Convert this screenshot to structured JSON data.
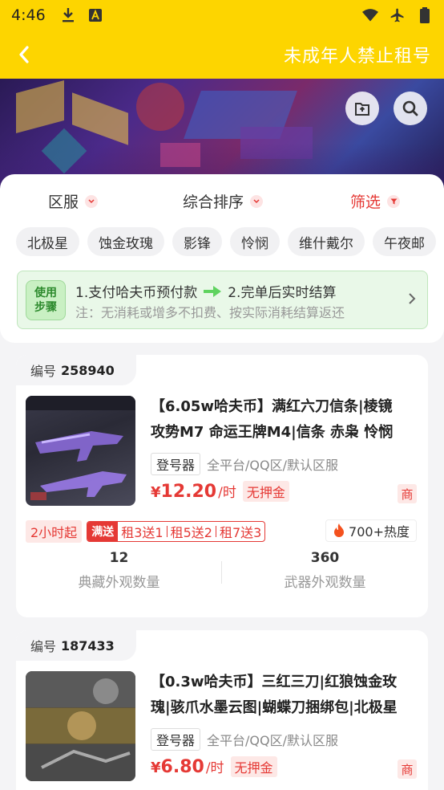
{
  "status_bar": {
    "time": "4:46"
  },
  "app_bar": {
    "title": "未成年人禁止租号"
  },
  "sort": {
    "region": "区服",
    "overall": "综合排序",
    "filter": "筛选"
  },
  "chips": [
    "北极星",
    "蚀金玫瑰",
    "影锋",
    "怜悯",
    "维什戴尔",
    "午夜邮"
  ],
  "steps": {
    "badge_line1": "使用",
    "badge_line2": "步骤",
    "step1": "1.支付哈夫币预付款",
    "step2": "2.完单后实时结算",
    "note": "注：无消耗或增多不扣费、按实际消耗结算返还"
  },
  "listings": [
    {
      "no_label": "编号",
      "no": "258940",
      "title_line1": "【6.05w哈夫币】满红六刀信条|棱镜",
      "title_line2": "攻势M7 命运王牌M4|信条 赤枭 怜悯",
      "tag": "登号器",
      "info": "全平台/QQ区/默认区服",
      "price_sym": "¥",
      "price": "12.20",
      "price_unit": "/时",
      "deposit": "无押金",
      "shang": "商",
      "min_time": "2小时起",
      "promo_tag": "满送",
      "promos": [
        "租3送1",
        "租5送2",
        "租7送3"
      ],
      "hot": "700+热度",
      "stat1_num": "12",
      "stat1_label": "典藏外观数量",
      "stat2_num": "360",
      "stat2_label": "武器外观数量"
    },
    {
      "no_label": "编号",
      "no": "187433",
      "title_line1": "【0.3w哈夫币】三红三刀|红狼蚀金玫",
      "title_line2": "瑰|骇爪水墨云图|蝴蝶刀捆绑包|北极星",
      "tag": "登号器",
      "info": "全平台/QQ区/默认区服",
      "price_sym": "¥",
      "price": "6.80",
      "price_unit": "/时",
      "deposit": "无押金",
      "shang": "商"
    }
  ]
}
